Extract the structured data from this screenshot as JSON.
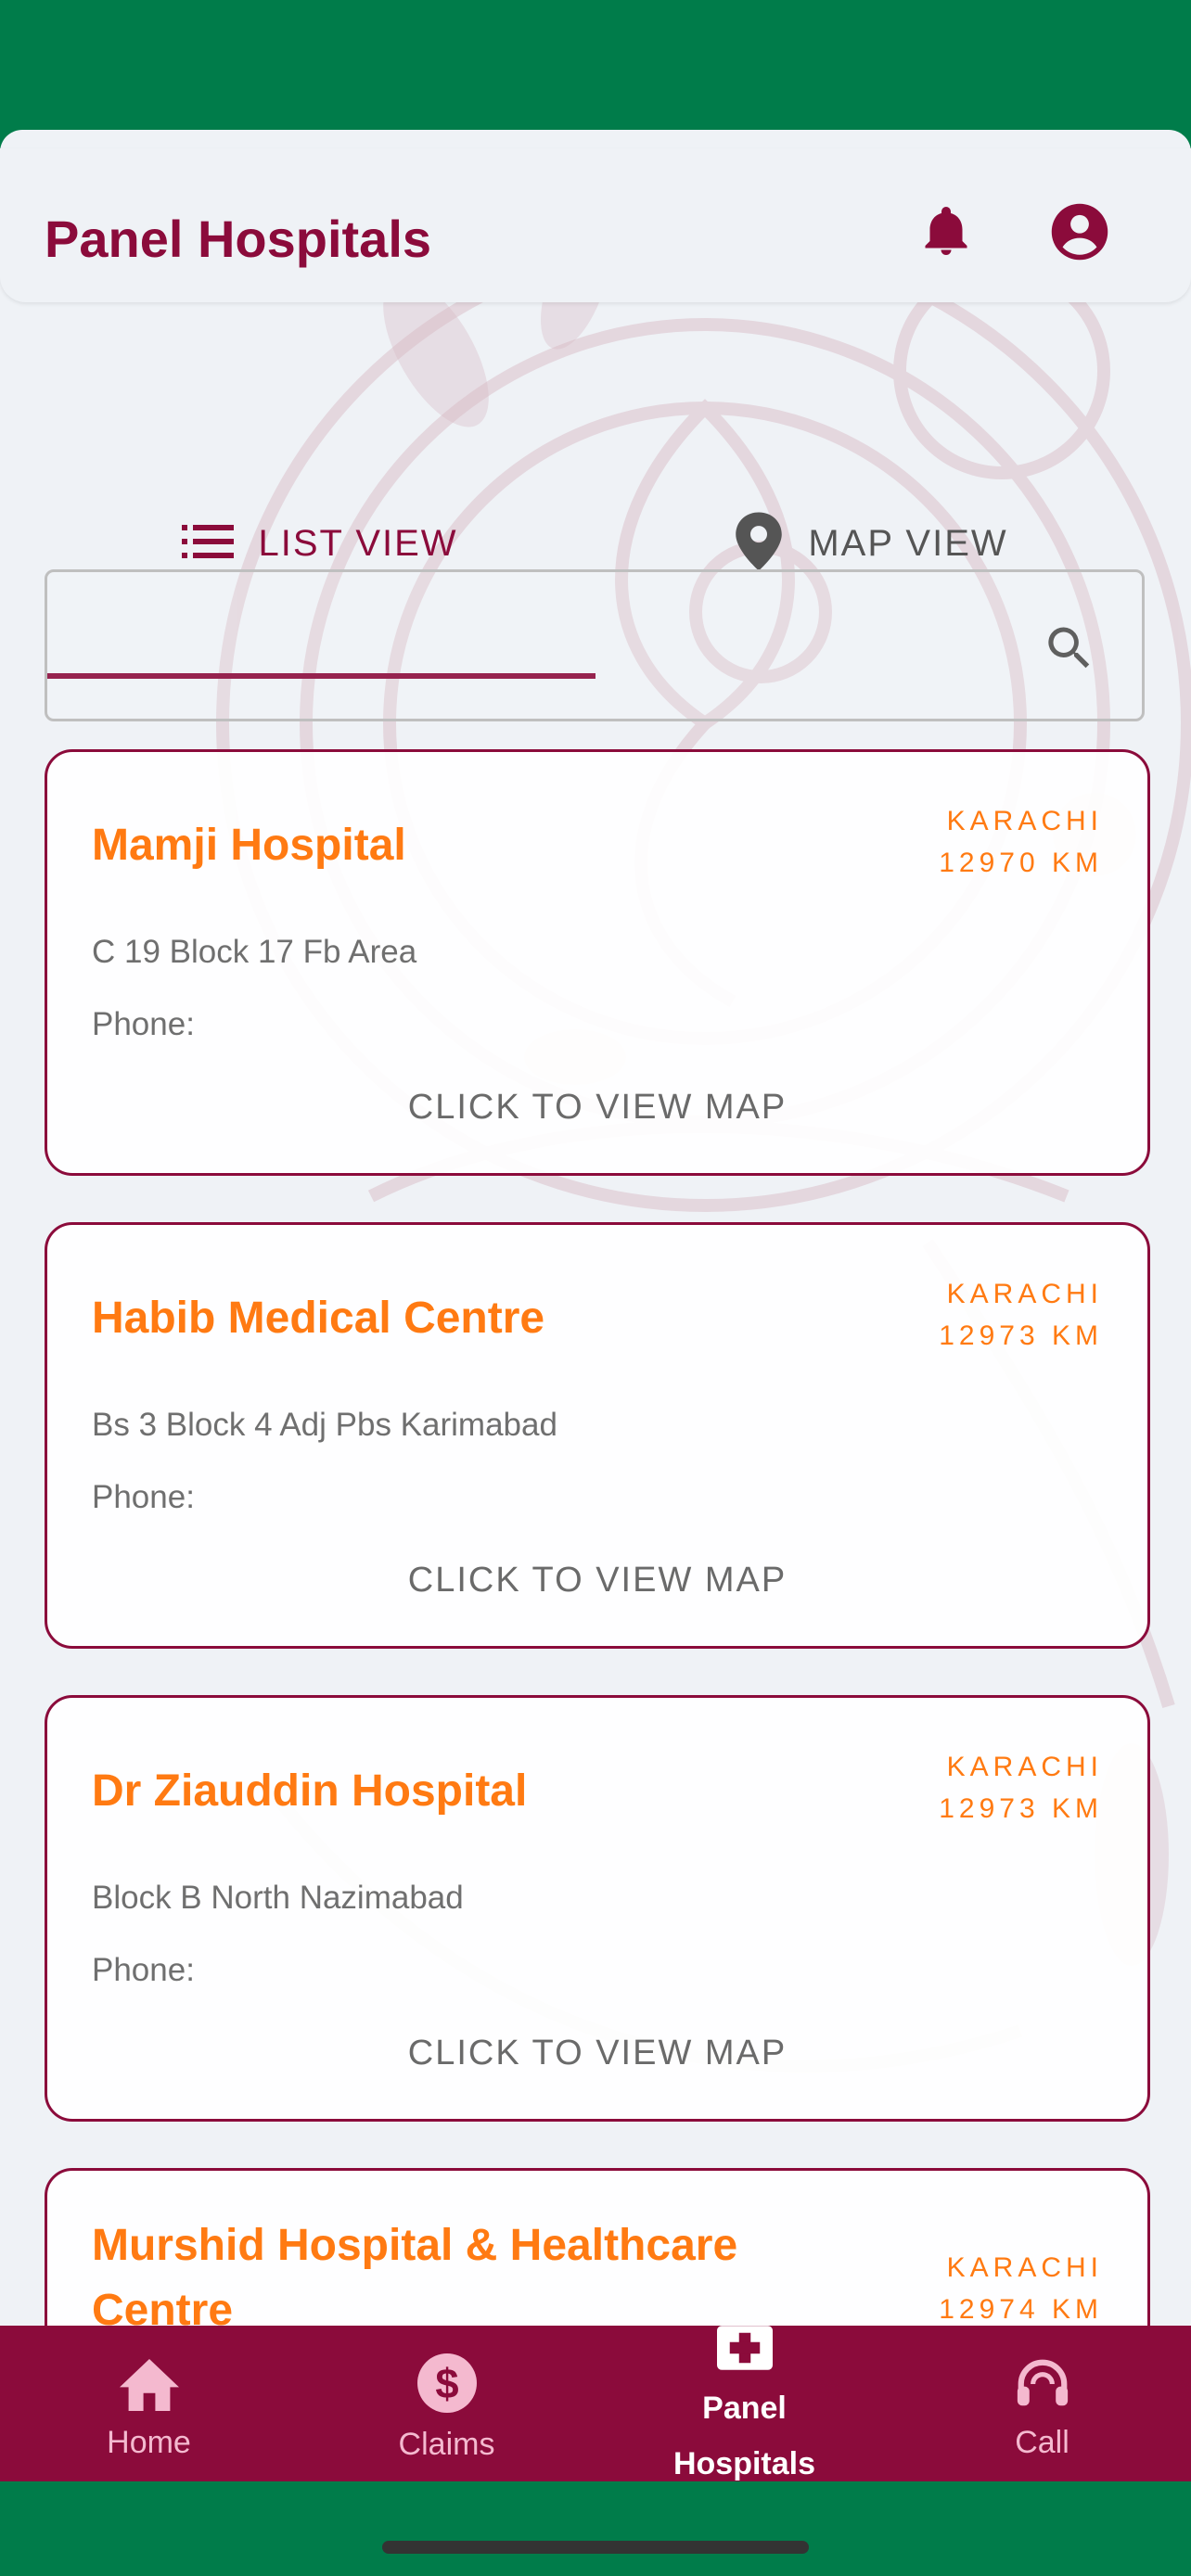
{
  "header": {
    "title": "Panel Hospitals"
  },
  "tabs": [
    {
      "label": "LIST VIEW",
      "icon": "list-icon",
      "active": true
    },
    {
      "label": "MAP VIEW",
      "icon": "map-pin-icon",
      "active": false
    }
  ],
  "search": {
    "value": "",
    "placeholder": ""
  },
  "hospitals": [
    {
      "name": "Mamji Hospital",
      "city": "KARACHI",
      "distance": "12970 KM",
      "address": "C 19 Block 17 Fb Area",
      "phone_label": "Phone:",
      "map_label": "CLICK TO VIEW MAP"
    },
    {
      "name": "Habib Medical Centre",
      "city": "KARACHI",
      "distance": "12973 KM",
      "address": "Bs 3 Block 4 Adj Pbs Karimabad",
      "phone_label": "Phone:",
      "map_label": "CLICK TO VIEW MAP"
    },
    {
      "name": "Dr Ziauddin Hospital",
      "city": "KARACHI",
      "distance": "12973 KM",
      "address": "Block B North Nazimabad",
      "phone_label": "Phone:",
      "map_label": "CLICK TO VIEW MAP"
    },
    {
      "name": "Murshid Hospital & Healthcare Centre",
      "city": "KARACHI",
      "distance": "12974 KM"
    }
  ],
  "nav": [
    {
      "label": "Home",
      "icon": "home-icon"
    },
    {
      "label": "Claims",
      "icon": "dollar-icon"
    },
    {
      "label": "Panel Hospitals",
      "icon": "medical-cross-icon",
      "active": true
    },
    {
      "label": "Call",
      "icon": "headset-icon"
    }
  ],
  "colors": {
    "brand": "#8b0b3b",
    "accent": "#ff7a12",
    "status_bar": "#007c4a"
  }
}
